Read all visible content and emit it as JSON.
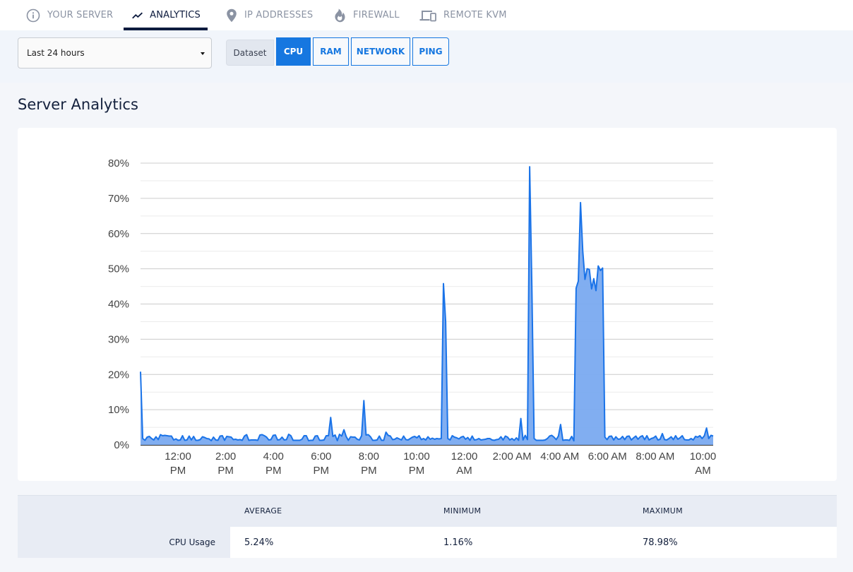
{
  "nav": {
    "tabs": [
      {
        "label": "YOUR SERVER",
        "icon": "info-icon",
        "active": false
      },
      {
        "label": "ANALYTICS",
        "icon": "trend-line-icon",
        "active": true
      },
      {
        "label": "IP ADDRESSES",
        "icon": "map-pin-icon",
        "active": false
      },
      {
        "label": "FIREWALL",
        "icon": "flame-icon",
        "active": false
      },
      {
        "label": "REMOTE KVM",
        "icon": "devices-icon",
        "active": false
      }
    ]
  },
  "controls": {
    "range_selected": "Last 24 hours",
    "dataset_label": "Dataset",
    "datasets": [
      {
        "label": "CPU",
        "active": true
      },
      {
        "label": "RAM",
        "active": false
      },
      {
        "label": "NETWORK",
        "active": false
      },
      {
        "label": "PING",
        "active": false
      }
    ]
  },
  "page_title": "Server Analytics",
  "colors": {
    "accent": "#1677e0",
    "line": "#1a73e8",
    "area": "#7aaaf0",
    "nav_active": "#0d1b3e"
  },
  "chart_data": {
    "type": "area",
    "title": "",
    "xlabel": "",
    "ylabel": "",
    "series_name": "CPU Usage",
    "ylim": [
      0,
      80
    ],
    "yticks": [
      "0%",
      "10%",
      "20%",
      "30%",
      "40%",
      "50%",
      "60%",
      "70%",
      "80%"
    ],
    "ytick_values": [
      0,
      10,
      20,
      30,
      40,
      50,
      60,
      70,
      80
    ],
    "xlim_hours": [
      0,
      24
    ],
    "xticks": [
      {
        "hour": 1.57,
        "label": [
          "12:00",
          "PM"
        ]
      },
      {
        "hour": 3.57,
        "label": [
          "2:00",
          "PM"
        ]
      },
      {
        "hour": 5.57,
        "label": [
          "4:00",
          "PM"
        ]
      },
      {
        "hour": 7.57,
        "label": [
          "6:00",
          "PM"
        ]
      },
      {
        "hour": 9.57,
        "label": [
          "8:00",
          "PM"
        ]
      },
      {
        "hour": 11.57,
        "label": [
          "10:00",
          "PM"
        ]
      },
      {
        "hour": 13.57,
        "label": [
          "12:00",
          "AM"
        ]
      },
      {
        "hour": 15.57,
        "label": [
          "2:00 AM"
        ]
      },
      {
        "hour": 17.57,
        "label": [
          "4:00 AM"
        ]
      },
      {
        "hour": 19.57,
        "label": [
          "6:00 AM"
        ]
      },
      {
        "hour": 21.57,
        "label": [
          "8:00 AM"
        ]
      },
      {
        "hour": 23.57,
        "label": [
          "10:00",
          "AM"
        ]
      }
    ],
    "grid": true,
    "legend": "none",
    "interval_minutes": 6,
    "values": [
      20.8,
      1.8,
      1.3,
      2.2,
      2.4,
      1.8,
      1.4,
      2.3,
      1.5,
      2.9,
      2.6,
      2.7,
      2.6,
      2.5,
      2.5,
      1.4,
      1.7,
      1.3,
      1.4,
      2.6,
      1.3,
      1.4,
      2.5,
      1.4,
      2.4,
      1.3,
      1.3,
      1.5,
      2.3,
      2.1,
      1.8,
      1.7,
      1.2,
      2.2,
      1.4,
      1.3,
      2.5,
      2.6,
      1.3,
      2.4,
      2.3,
      2.2,
      1.5,
      1.6,
      1.4,
      1.5,
      1.3,
      2.5,
      2.9,
      1.3,
      1.4,
      1.4,
      1.4,
      1.3,
      2.8,
      2.9,
      2.6,
      2.2,
      1.4,
      1.5,
      2.7,
      2.8,
      1.4,
      1.5,
      2.2,
      1.4,
      1.5,
      3.0,
      2.6,
      1.3,
      1.3,
      1.3,
      1.3,
      1.6,
      2.6,
      2.6,
      1.2,
      1.3,
      1.3,
      2.5,
      2.6,
      1.3,
      1.3,
      1.4,
      2.6,
      2.6,
      7.8,
      2.4,
      2.8,
      1.2,
      3.0,
      2.5,
      4.3,
      2.4,
      1.3,
      2.3,
      2.2,
      2.2,
      1.6,
      1.4,
      2.6,
      12.6,
      2.8,
      2.9,
      2.3,
      1.3,
      1.3,
      1.4,
      2.5,
      1.3,
      1.3,
      3.6,
      2.7,
      2.5,
      1.5,
      1.6,
      2.0,
      1.7,
      1.4,
      2.5,
      1.5,
      1.4,
      1.8,
      2.2,
      2.4,
      2.0,
      2.6,
      1.5,
      1.8,
      1.4,
      2.3,
      1.6,
      1.9,
      1.6,
      1.8,
      1.7,
      1.8,
      45.8,
      35.0,
      1.8,
      1.4,
      2.6,
      2.2,
      2.0,
      1.7,
      2.2,
      2.4,
      1.6,
      2.1,
      1.3,
      2.5,
      1.4,
      1.5,
      1.8,
      1.4,
      1.5,
      1.6,
      1.8,
      1.8,
      1.4,
      1.3,
      1.5,
      1.6,
      2.3,
      1.4,
      2.5,
      2.2,
      1.4,
      1.8,
      1.3,
      2.0,
      1.3,
      7.5,
      1.4,
      2.7,
      1.5,
      78.98,
      45.0,
      1.8,
      1.3,
      1.3,
      1.3,
      1.3,
      1.4,
      1.8,
      2.5,
      2.7,
      2.2,
      1.5,
      2.5,
      5.8,
      1.3,
      1.4,
      1.4,
      1.3,
      2.4,
      1.16,
      44.5,
      46.5,
      68.8,
      55.0,
      47.0,
      50.0,
      49.8,
      44.3,
      47.2,
      43.8,
      50.8,
      49.5,
      50.2,
      2.2,
      1.5,
      2.4,
      2.5,
      1.4,
      2.3,
      1.6,
      1.7,
      2.4,
      1.5,
      2.4,
      2.5,
      1.4,
      2.0,
      2.5,
      1.6,
      2.3,
      2.6,
      1.5,
      2.6,
      1.4,
      1.8,
      2.0,
      2.5,
      1.4,
      1.6,
      3.2,
      1.5,
      1.4,
      1.8,
      2.3,
      1.5,
      2.6,
      1.6,
      2.0,
      2.6,
      1.5,
      1.4,
      1.4,
      1.8,
      1.4,
      2.4,
      2.2,
      2.6,
      1.8,
      2.6,
      4.8,
      1.8,
      2.7,
      2.5
    ]
  },
  "stats": {
    "headers": [
      "AVERAGE",
      "MINIMUM",
      "MAXIMUM"
    ],
    "row_label": "CPU Usage",
    "values": [
      "5.24%",
      "1.16%",
      "78.98%"
    ]
  }
}
